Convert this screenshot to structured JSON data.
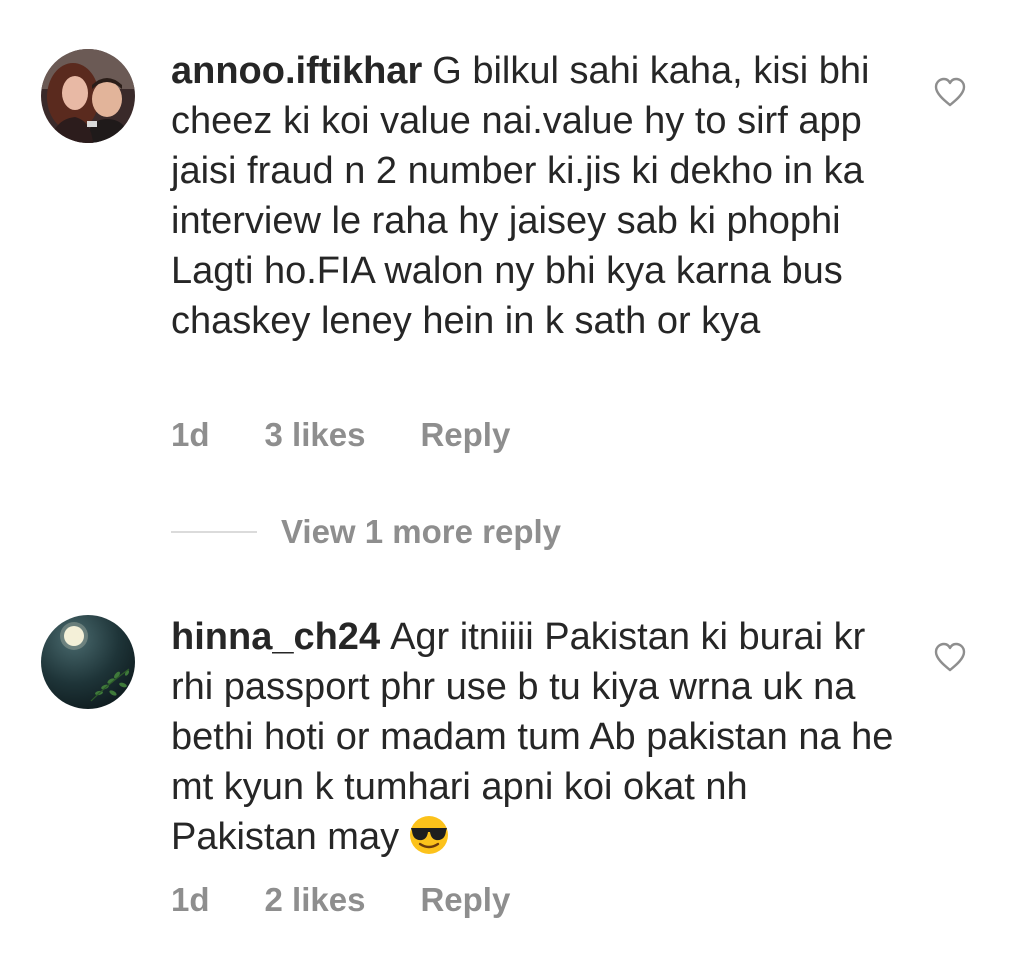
{
  "comments": [
    {
      "username": "annoo.iftikhar",
      "text": "G bilkul sahi kaha, kisi bhi cheez ki koi value nai.value hy to sirf app jaisi fraud n 2 number ki.jis ki dekho in ka interview le raha hy jaisey sab ki phophi Lagti ho.FIA walon ny bhi kya karna bus chaskey leney hein in k sath or kya",
      "time": "1d",
      "likes": "3 likes",
      "reply_label": "Reply",
      "like_icon": "heart-outline-icon"
    },
    {
      "username": "hinna_ch24",
      "text": "Agr itniiii Pakistan ki burai kr rhi passport phr use b tu kiya wrna uk na bethi hoti or madam tum Ab pakistan na he mt kyun k tumhari apni koi okat nh Pakistan may",
      "emoji": "smiling-face-with-sunglasses-emoji",
      "time": "1d",
      "likes": "2 likes",
      "reply_label": "Reply",
      "like_icon": "heart-outline-icon"
    }
  ],
  "view_more_replies": "View 1 more reply",
  "colors": {
    "text": "#262626",
    "secondary_text": "#8e8e8e",
    "divider": "#dbdbdb",
    "background": "#ffffff"
  }
}
